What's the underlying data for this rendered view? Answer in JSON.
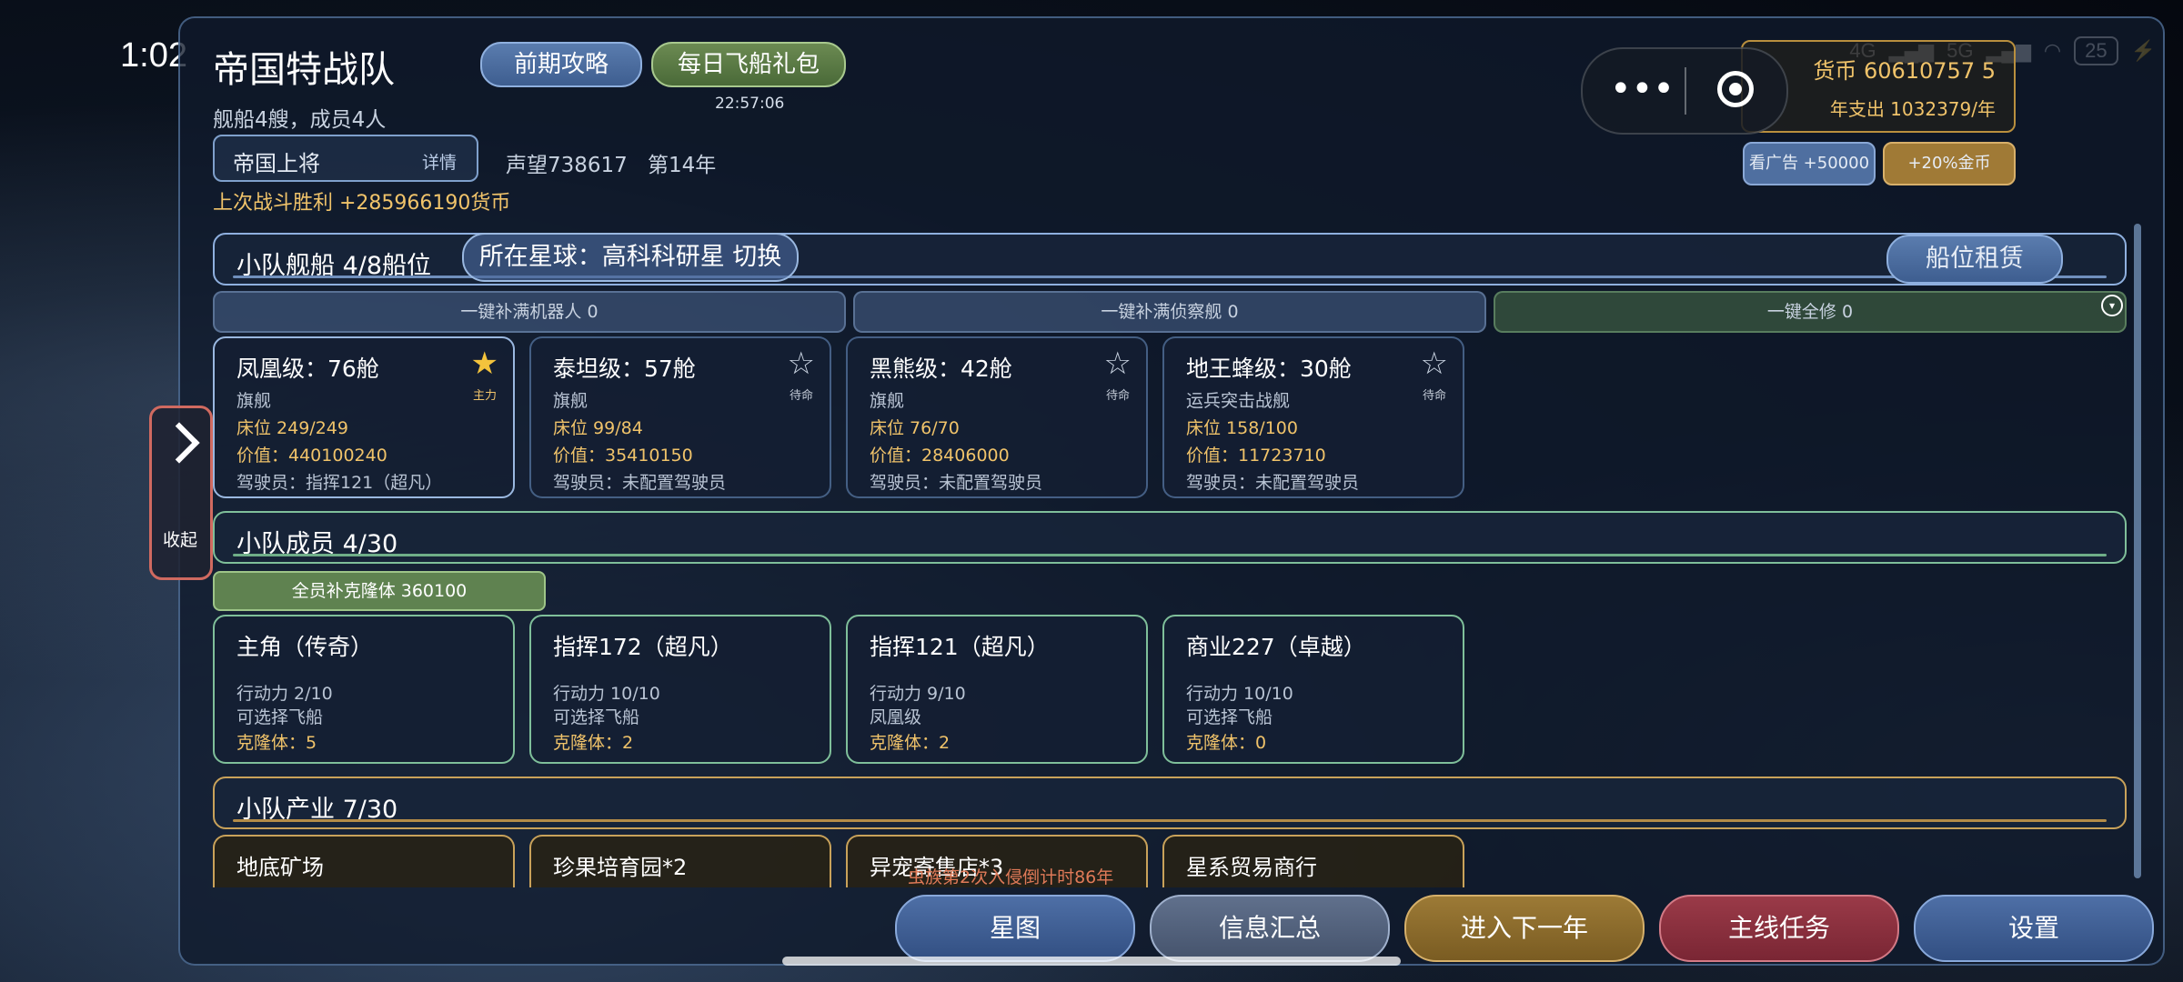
{
  "status_bar": {
    "time": "1:02",
    "net1": "4G",
    "net2": "5G",
    "battery": "25"
  },
  "header": {
    "title": "帝国特战队",
    "subtitle": "舰船4艘，成员4人",
    "guide_button": "前期攻略",
    "daily_gift_button": "每日飞船礼包",
    "gift_timer": "22:57:06",
    "rank": "帝国上将",
    "rank_detail": "详情",
    "prestige": "声望738617",
    "year": "第14年",
    "last_battle": "上次战斗胜利 +285966190货币",
    "currency": "货币 60610757 5",
    "annual_expense": "年支出 1032379/年",
    "ad_button": "看广告 +50000",
    "gold_button": "+20%金币"
  },
  "side_tab": {
    "label": "收起"
  },
  "ships_section": {
    "title": "小队舰船    4/8船位",
    "planet": "所在星球：高科科研星  切换",
    "rent_button": "船位租赁",
    "fill_robots": "一键补满机器人 0",
    "fill_scouts": "一键补满侦察舰 0",
    "repair_all": "一键全修 0",
    "ships": [
      {
        "name": "凤凰级：76舱",
        "type": "旗舰",
        "berth": "床位 249/249",
        "value": "价值：440100240",
        "pilot": "驾驶员：指挥121（超凡）",
        "status": "主力",
        "star": "★"
      },
      {
        "name": "泰坦级：57舱",
        "type": "旗舰",
        "berth": "床位 99/84",
        "value": "价值：35410150",
        "pilot": "驾驶员：未配置驾驶员",
        "status": "待命",
        "star": "☆"
      },
      {
        "name": "黑熊级：42舱",
        "type": "旗舰",
        "berth": "床位 76/70",
        "value": "价值：28406000",
        "pilot": "驾驶员：未配置驾驶员",
        "status": "待命",
        "star": "☆"
      },
      {
        "name": "地王蜂级：30舱",
        "type": "运兵突击战舰",
        "berth": "床位 158/100",
        "value": "价值：11723710",
        "pilot": "驾驶员：未配置驾驶员",
        "status": "待命",
        "star": "☆"
      }
    ]
  },
  "members_section": {
    "title": "小队成员    4/30",
    "clone_button": "全员补克隆体 360100",
    "members": [
      {
        "name": "主角（传奇）",
        "action": "行动力 2/10",
        "ship": "可选择飞船",
        "clones": "克隆体：5"
      },
      {
        "name": "指挥172（超凡）",
        "action": "行动力 10/10",
        "ship": "可选择飞船",
        "clones": "克隆体：2"
      },
      {
        "name": "指挥121（超凡）",
        "action": "行动力 9/10",
        "ship": "凤凰级",
        "clones": "克隆体：2"
      },
      {
        "name": "商业227（卓越）",
        "action": "行动力 10/10",
        "ship": "可选择飞船",
        "clones": "克隆体：0"
      }
    ]
  },
  "industry_section": {
    "title": "小队产业    7/30",
    "items": [
      "地底矿场",
      "珍果培育园*2",
      "异宠寄售店*3",
      "星系贸易商行"
    ],
    "invasion_notice": "虫族第2次入侵倒计时86年"
  },
  "bottom_nav": [
    "星图",
    "信息汇总",
    "进入下一年",
    "主线任务",
    "设置"
  ],
  "colors": {
    "accent_blue": "#4e6fa6",
    "gold": "#f0c36a",
    "green": "#5f8250",
    "red": "#9a3a48"
  }
}
